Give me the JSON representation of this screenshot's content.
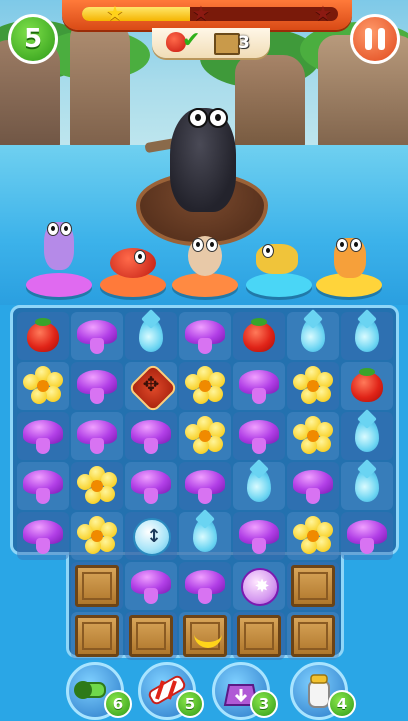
{
  "hud": {
    "moves_left": "5",
    "progress_fraction": 0.42,
    "stars": [
      {
        "name": "star-1",
        "filled": true
      },
      {
        "name": "star-2",
        "filled": false
      },
      {
        "name": "star-3",
        "filled": false
      }
    ]
  },
  "goals": {
    "strawberry_complete": true,
    "crates_remaining": "3"
  },
  "board": {
    "rows": [
      [
        "strawberry",
        "mushroom",
        "drop",
        "mushroom",
        "strawberry",
        "drop",
        "drop"
      ],
      [
        "flower",
        "mushroom",
        "bomb",
        "flower",
        "mushroom",
        "flower",
        "strawberry"
      ],
      [
        "mushroom",
        "mushroom",
        "mushroom",
        "flower",
        "mushroom",
        "flower",
        "drop"
      ],
      [
        "mushroom",
        "flower",
        "mushroom",
        "mushroom",
        "drop",
        "mushroom",
        "drop"
      ],
      [
        "mushroom",
        "flower",
        "vertical-bomb",
        "drop",
        "mushroom",
        "flower",
        "mushroom"
      ],
      [
        null,
        "crate",
        "mushroom",
        "mushroom",
        "burst-bomb",
        "crate",
        null
      ],
      [
        null,
        "crate",
        "crate",
        "banana-crate",
        "crate",
        "crate",
        null
      ]
    ]
  },
  "boosters": [
    {
      "name": "blaster",
      "count": "6"
    },
    {
      "name": "candy-stick",
      "count": "5"
    },
    {
      "name": "weight",
      "count": "3"
    },
    {
      "name": "salt-shaker",
      "count": "4"
    }
  ],
  "colors": {
    "accent_orange": "#e0481c",
    "accent_green": "#2e9a18",
    "water_blue": "#3cb2ea"
  }
}
